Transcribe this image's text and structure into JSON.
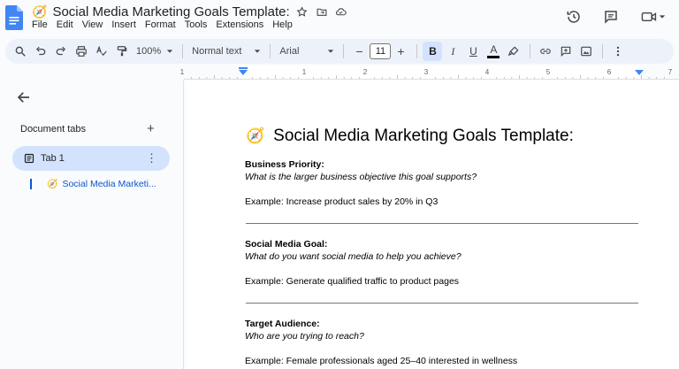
{
  "app": {
    "title_emoji": "🧭",
    "doc_title": "Social Media Marketing Goals Template:",
    "brand_color": "#4285f4"
  },
  "menu": [
    "File",
    "Edit",
    "View",
    "Insert",
    "Format",
    "Tools",
    "Extensions",
    "Help"
  ],
  "toolbar": {
    "zoom": "100%",
    "style": "Normal text",
    "font": "Arial",
    "font_size": "11",
    "minus": "−",
    "plus": "+",
    "bold": "B",
    "italic": "I",
    "underline": "U",
    "text_color_label": "A"
  },
  "ruler": {
    "ticks": [
      "1",
      "1",
      "2",
      "3",
      "4",
      "5",
      "6",
      "7"
    ]
  },
  "sidebar": {
    "section_label": "Document tabs",
    "add_label": "+",
    "tab_label": "Tab 1",
    "more_label": "⋮",
    "outline_emoji": "🧭",
    "outline_text": "Social Media Marketi..."
  },
  "document": {
    "heading_emoji": "🧭",
    "heading": "Social Media Marketing Goals Template:",
    "sections": [
      {
        "title": "Business Priority:",
        "question": "What is the larger business objective this goal supports?",
        "example": "Example: Increase product sales by 20% in Q3"
      },
      {
        "title": "Social Media Goal:",
        "question": "What do you want social media to help you achieve?",
        "example": "Example: Generate qualified traffic to product pages"
      },
      {
        "title": "Target Audience:",
        "question": "Who are you trying to reach?",
        "example": "Example: Female professionals aged 25–40 interested in wellness"
      }
    ]
  }
}
